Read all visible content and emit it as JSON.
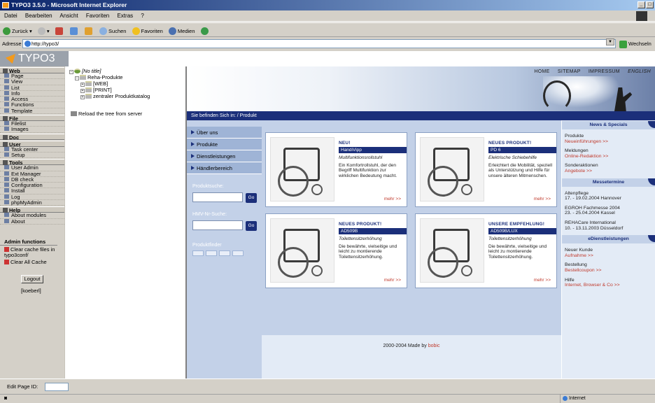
{
  "window": {
    "title": "TYPO3 3.5.0 - Microsoft Internet Explorer"
  },
  "menu": [
    "Datei",
    "Bearbeiten",
    "Ansicht",
    "Favoriten",
    "Extras",
    "?"
  ],
  "toolbar": {
    "back": "Zurück",
    "search": "Suchen",
    "favorites": "Favoriten",
    "media": "Medien"
  },
  "address": {
    "label": "Adresse",
    "url": "http://typo3/",
    "go": "Wechseln zu"
  },
  "typo3": {
    "logo": "TYPO3"
  },
  "modules": [
    {
      "group": "Web",
      "items": [
        "Page",
        "View",
        "List",
        "Info",
        "Access",
        "Functions",
        "Template"
      ]
    },
    {
      "group": "File",
      "items": [
        "Filelist",
        "Images"
      ]
    },
    {
      "group": "Doc",
      "items": []
    },
    {
      "group": "User",
      "items": [
        "Task center",
        "Setup"
      ]
    },
    {
      "group": "Tools",
      "items": [
        "User Admin",
        "Ext Manager",
        "DB check",
        "Configuration",
        "Install",
        "Log",
        "phpMyAdmin"
      ]
    },
    {
      "group": "Help",
      "items": [
        "About modules",
        "About"
      ]
    }
  ],
  "admin": {
    "title": "Admin functions",
    "clear_conf": "Clear cache files in typo3conf/",
    "clear_all": "Clear All Cache",
    "logout": "Logout",
    "user": "[koeberl]"
  },
  "tree": {
    "root": "[No title]",
    "n1": "Reha-Produkte",
    "n2": "[WEB]",
    "n3": "[PRINT]",
    "n4": "zentraler Produktkatalog",
    "reload": "Reload the tree from server"
  },
  "site": {
    "topnav": [
      "HOME",
      "SITEMAP",
      "IMPRESSUM",
      "ENGLISH"
    ],
    "breadcrumb": "Sie befinden Sich in:  / Produkt",
    "leftnav": [
      "Über uns",
      "Produkte",
      "Dienstleistungen",
      "Händlerbereich"
    ],
    "search1": "Produktsuche:",
    "search2": "HMV-Nr-Suche:",
    "finder": "Produktfinder",
    "go": "Go",
    "cards": [
      {
        "title": "NEU!",
        "name": "HandiVipp",
        "sub": "Multifunktionsrollstuhl",
        "desc": "Ein Komfortrollstuhl, der den Begriff Multifunktion zur wirklichen Bedeutung macht.",
        "more": "mehr >>"
      },
      {
        "title": "NEUES PRODUKT!",
        "name": "PD 6",
        "sub": "Elektrische Schiebehilfe",
        "desc": "Erleichtert die Mobilität, speziell als Unterstützung und Hilfe für unsere älteren Mitmenschen.",
        "more": "mehr >>"
      },
      {
        "title": "NEUES PRODUKT!",
        "name": "AD509B",
        "sub": "Toilettensitzerhöhung",
        "desc": "Die bewährte, vielseitige und leicht zu montierende Toilettensitzerhöhung.",
        "more": "mehr >>"
      },
      {
        "title": "UNSERE EMPFEHLUNG!",
        "name": "AD509B/LUX",
        "sub": "Toilettensitzerhöhung",
        "desc": "Die bewährte, vielseitige und leicht zu montierende Toilettensitzerhöhung.",
        "more": "mehr >>"
      }
    ],
    "footer": "2000-2004 Made by",
    "footer_by": "bobic",
    "news": {
      "head": "News & Specials",
      "items": [
        {
          "t": "Produkte",
          "l": "Neueinführungen >>"
        },
        {
          "t": "Meldungen",
          "l": "Online-Redaktion >>"
        },
        {
          "t": "Sonderaktionen",
          "l": "Angebote >>"
        }
      ]
    },
    "messe": {
      "head": "Messetermine",
      "items": [
        {
          "t": "Altenpflege",
          "d": "17. - 19.02.2004 Hannover"
        },
        {
          "t": "EGROH Fachmesse 2004",
          "d": "23. - 25.04.2004 Kassel"
        },
        {
          "t": "REHACare International",
          "d": "10. - 13.11.2003 Düsseldorf"
        }
      ]
    },
    "dienst": {
      "head": "eDienstleistungen",
      "items": [
        {
          "t": "Neuer Kunde",
          "l": "Aufnahme >>"
        },
        {
          "t": "Bestellung",
          "l": "Bestellcoupon >>"
        },
        {
          "t": "Hilfe",
          "l": "Internet, Browser & Co >>"
        }
      ]
    }
  },
  "editbar": {
    "label": "Edit Page ID:"
  },
  "status": {
    "zone": "Internet"
  }
}
